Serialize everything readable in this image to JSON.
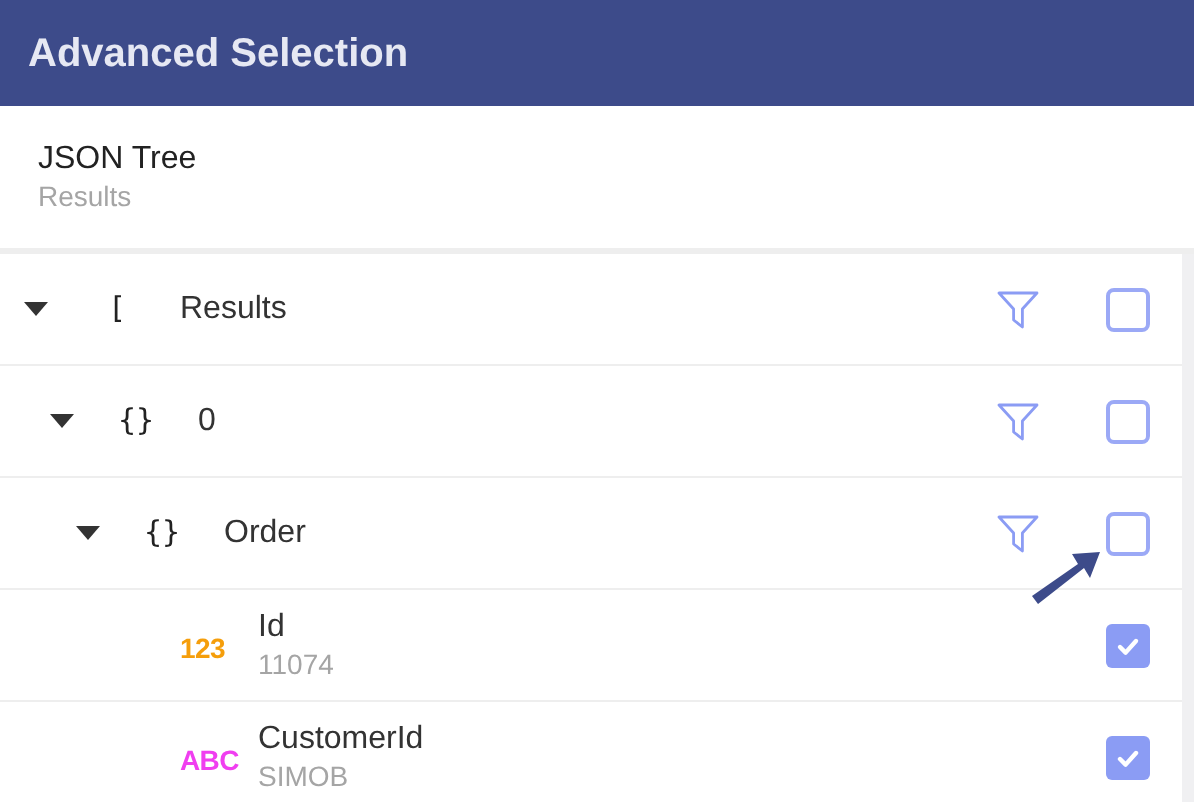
{
  "header": {
    "title": "Advanced Selection"
  },
  "panel": {
    "title": "JSON Tree",
    "subtitle": "Results"
  },
  "tree": [
    {
      "kind": "array",
      "bracket": "[",
      "label": "Results",
      "expanded": true,
      "checked": false,
      "children": [
        {
          "kind": "object",
          "bracket": "{}",
          "label": "0",
          "expanded": true,
          "checked": false,
          "children": [
            {
              "kind": "object",
              "bracket": "{}",
              "label": "Order",
              "expanded": true,
              "checked": false,
              "children": [
                {
                  "kind": "number",
                  "badge": "123",
                  "label": "Id",
                  "value": "11074",
                  "checked": true
                },
                {
                  "kind": "string",
                  "badge": "ABC",
                  "label": "CustomerId",
                  "value": "SIMOB",
                  "checked": true
                }
              ]
            }
          ]
        }
      ]
    }
  ]
}
